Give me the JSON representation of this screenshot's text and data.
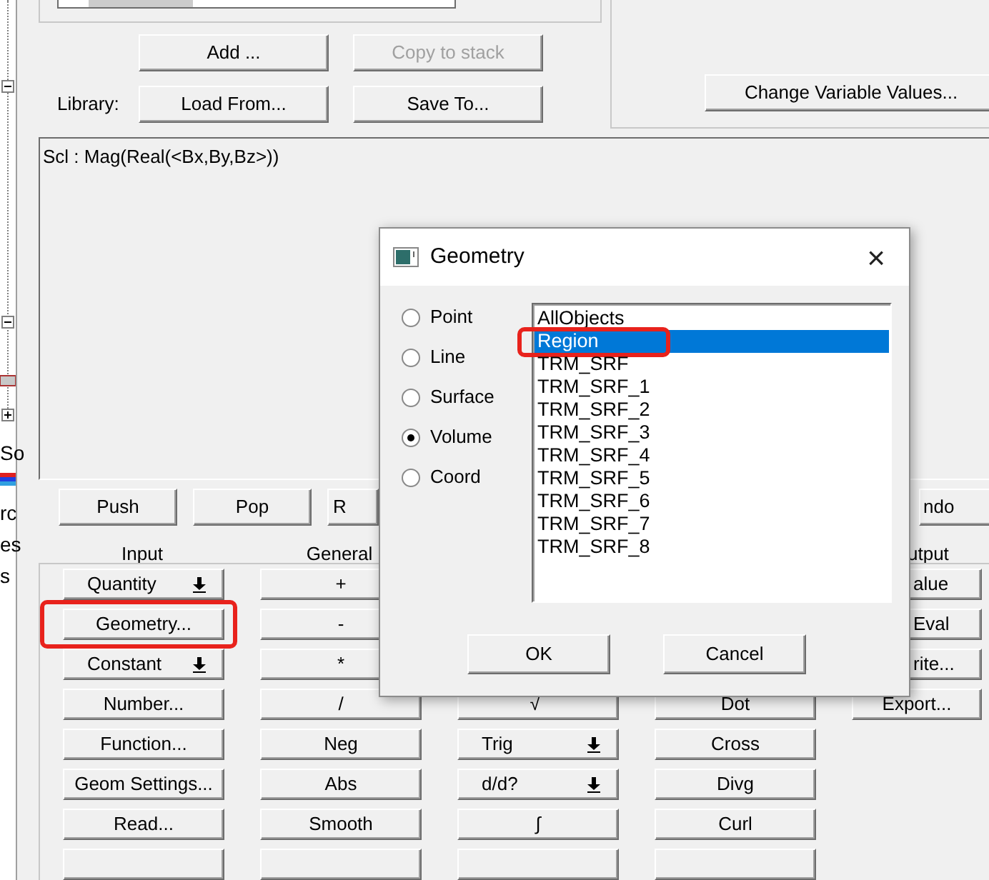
{
  "tree": [
    {
      "kind": "toggle",
      "expanded": true
    },
    {
      "kind": "toggle",
      "expanded": true
    },
    {
      "kind": "icon"
    },
    {
      "kind": "toggle",
      "expanded": false
    },
    {
      "kind": "label",
      "text": "So"
    },
    {
      "kind": "icon"
    },
    {
      "kind": "label",
      "text": "rc"
    },
    {
      "kind": "label",
      "text": "es"
    },
    {
      "kind": "label",
      "text": "s"
    }
  ],
  "library": {
    "buttons": [
      {
        "label": "Add ...",
        "disabled": false
      },
      {
        "label": "Copy to stack",
        "disabled": true
      }
    ],
    "label": "Library:",
    "lib_buttons": [
      {
        "label": "Load From...",
        "disabled": false
      },
      {
        "label": "Save To...",
        "disabled": false
      }
    ]
  },
  "change_button": "Change Variable Values...",
  "stack": [
    "Scl : Mag(Real(<Bx,By,Bz>))"
  ],
  "stack_buttons": [
    {
      "label": "Push",
      "kind": "plain"
    },
    {
      "label": "Pop",
      "kind": "plain"
    },
    {
      "label": "R",
      "kind": "clipped"
    }
  ],
  "undo_button": {
    "label": "ndo",
    "kind": "clipped"
  },
  "headers": {
    "input": "Input",
    "general": "General",
    "output": "utput"
  },
  "columns": [
    [
      {
        "label": "Quantity",
        "kind": "menu"
      },
      {
        "label": "Geometry...",
        "kind": "plain",
        "highlighted": true
      },
      {
        "label": "Constant",
        "kind": "menu"
      },
      {
        "label": "Number...",
        "kind": "plain"
      },
      {
        "label": "Function...",
        "kind": "plain"
      },
      {
        "label": "Geom Settings...",
        "kind": "plain"
      },
      {
        "label": "Read...",
        "kind": "plain"
      },
      {
        "kind": "covered"
      }
    ],
    [
      {
        "label": "+",
        "kind": "plain"
      },
      {
        "label": "-",
        "kind": "plain"
      },
      {
        "label": "*",
        "kind": "plain"
      },
      {
        "label": "/",
        "kind": "plain"
      },
      {
        "label": "Neg",
        "kind": "plain"
      },
      {
        "label": "Abs",
        "kind": "plain"
      },
      {
        "label": "Smooth",
        "kind": "plain"
      },
      {
        "kind": "covered"
      }
    ],
    [
      null,
      null,
      {
        "kind": "covered"
      },
      {
        "label": "√‾",
        "kind": "plain"
      },
      {
        "label": "Trig",
        "kind": "menu"
      },
      {
        "label": "d/d?",
        "kind": "menu"
      },
      {
        "label": "∫",
        "kind": "plain"
      },
      {
        "kind": "covered"
      }
    ],
    [
      null,
      null,
      {
        "kind": "covered"
      },
      {
        "label": "Dot",
        "kind": "plain"
      },
      {
        "label": "Cross",
        "kind": "plain"
      },
      {
        "label": "Divg",
        "kind": "plain"
      },
      {
        "label": "Curl",
        "kind": "plain"
      },
      {
        "kind": "covered"
      }
    ],
    [
      {
        "label": "alue",
        "kind": "clipped"
      },
      {
        "label": "Eval",
        "kind": "clipped"
      },
      {
        "label": "rite...",
        "kind": "clipped"
      },
      {
        "label": "Export...",
        "kind": "plain"
      }
    ]
  ],
  "dialog": {
    "title": "Geometry",
    "close": "×",
    "radios": [
      {
        "label": "Point",
        "selected": false
      },
      {
        "label": "Line",
        "selected": false
      },
      {
        "label": "Surface",
        "selected": false
      },
      {
        "label": "Volume",
        "selected": true
      },
      {
        "label": "Coord",
        "selected": false
      }
    ],
    "items": [
      {
        "label": "AllObjects",
        "selected": false,
        "highlighted": false
      },
      {
        "label": "Region",
        "selected": true,
        "highlighted": true
      },
      {
        "label": "TRM_SRF",
        "selected": false,
        "highlighted": false
      },
      {
        "label": "TRM_SRF_1",
        "selected": false,
        "highlighted": false
      },
      {
        "label": "TRM_SRF_2",
        "selected": false,
        "highlighted": false
      },
      {
        "label": "TRM_SRF_3",
        "selected": false,
        "highlighted": false
      },
      {
        "label": "TRM_SRF_4",
        "selected": false,
        "highlighted": false
      },
      {
        "label": "TRM_SRF_5",
        "selected": false,
        "highlighted": false
      },
      {
        "label": "TRM_SRF_6",
        "selected": false,
        "highlighted": false
      },
      {
        "label": "TRM_SRF_7",
        "selected": false,
        "highlighted": false
      },
      {
        "label": "TRM_SRF_8",
        "selected": false,
        "highlighted": false
      }
    ],
    "buttons": [
      "OK",
      "Cancel"
    ]
  }
}
